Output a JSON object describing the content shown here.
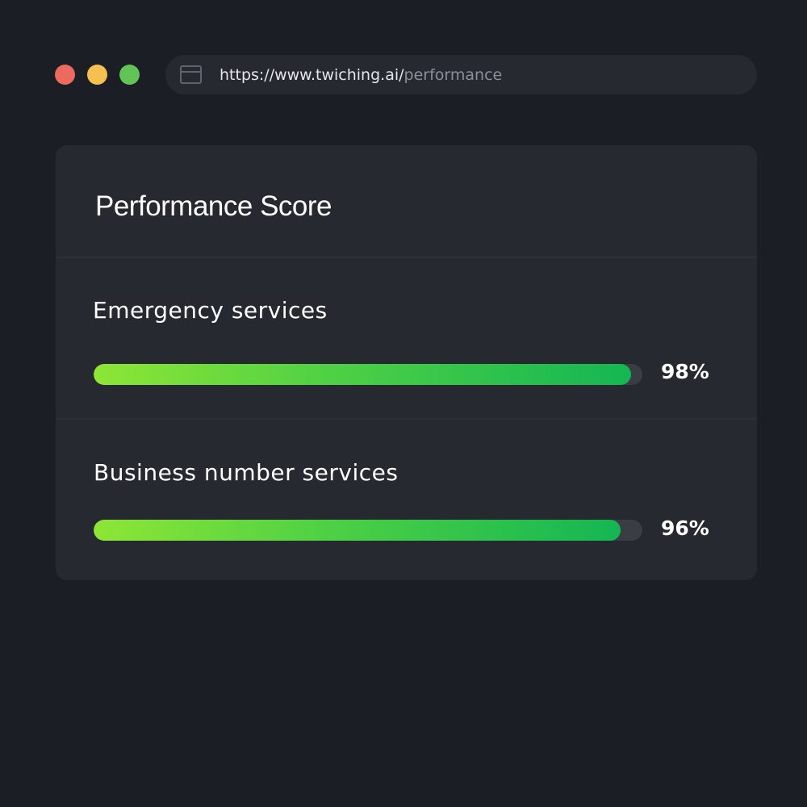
{
  "window": {
    "url_base": "https://www.twiching.ai/",
    "url_path": "performance"
  },
  "card": {
    "title": "Performance Score",
    "metrics": [
      {
        "label": "Emergency services",
        "value_text": "98%",
        "value": 98
      },
      {
        "label": "Business number services",
        "value_text": "96%",
        "value": 96
      }
    ]
  },
  "colors": {
    "background": "#1c1e25",
    "card": "#262930",
    "bar_start": "#8ee635",
    "bar_end": "#14b653",
    "track": "#3a3d44"
  },
  "icons": [
    "window-close-dot",
    "window-minimize-dot",
    "window-maximize-dot",
    "browser-tab-icon"
  ]
}
